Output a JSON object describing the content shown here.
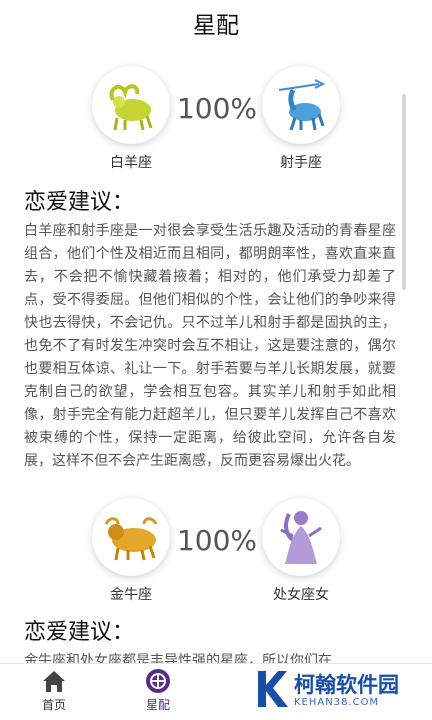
{
  "header": {
    "title": "星配"
  },
  "pairs": [
    {
      "left": {
        "name": "白羊座",
        "icon": "aries-icon"
      },
      "right": {
        "name": "射手座",
        "icon": "sagittarius-icon"
      },
      "percent": "100%",
      "advice_title": "恋爱建议：",
      "advice_text": "白羊座和射手座是一对很会享受生活乐趣及活动的青春星座组合，他们个性及相近而且相同，都明朗率性，喜欢直来直去，不会把不愉快藏着掖着；相对的，他们承受力却差了点，受不得委屈。但他们相似的个性，会让他们的争吵来得快也去得快，不会记仇。只不过羊儿和射手都是固执的主，也免不了有时发生冲突时会互不相让，这是要注意的，偶尔也要相互体谅、礼让一下。射手若要与羊儿长期发展，就要克制自己的欲望，学会相互包容。其实羊儿和射手如此相像，射手完全有能力赶超羊儿，但只要羊儿发挥自己不喜欢被束缚的个性，保持一定距离，给彼此空间，允许各自发展，这样不但不会产生距离感，反而更容易爆出火花。"
    },
    {
      "left": {
        "name": "金牛座",
        "icon": "taurus-icon"
      },
      "right": {
        "name": "处女座女",
        "icon": "virgo-icon"
      },
      "percent": "100%",
      "advice_title": "恋爱建议：",
      "advice_text": "金牛座和处女座都是丰导性强的星座，所以你们在"
    }
  ],
  "nav": {
    "items": [
      {
        "label": "首页",
        "icon": "home-icon",
        "active": false
      },
      {
        "label": "星配",
        "icon": "match-icon",
        "active": true
      }
    ]
  },
  "watermark": {
    "main": "柯翰软件园",
    "sub": "KEHAN38.COM",
    "logo": "k-logo-icon"
  },
  "colors": {
    "active": "#5b2a86",
    "watermark": "#1a4fa8"
  }
}
